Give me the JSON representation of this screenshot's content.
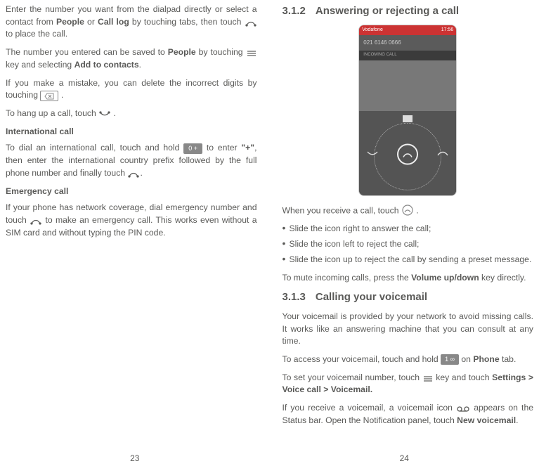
{
  "leftPage": {
    "p1_a": "Enter the number you want from the dialpad directly or select a contact from ",
    "p1_b": "People",
    "p1_c": " or ",
    "p1_d": "Call log",
    "p1_e": " by touching tabs, then touch ",
    "p1_f": " to place the call.",
    "p2_a": "The number you entered can be saved to ",
    "p2_b": "People",
    "p2_c": " by touching ",
    "p2_d": " key and selecting ",
    "p2_e": "Add to contacts",
    "p2_f": ".",
    "p3_a": "If you make a mistake, you can delete the incorrect digits by touching ",
    "p3_b": " .",
    "p4_a": "To hang up a call, touch ",
    "p4_b": " .",
    "h1": "International call",
    "p5_a": "To dial an international call, touch and hold ",
    "p5_key": "0 +",
    "p5_b": " to enter ",
    "p5_c": "\"+\"",
    "p5_d": ", then enter the international country prefix followed by the full phone number and finally touch ",
    "p5_e": ".",
    "h2": "Emergency call",
    "p6_a": "If your phone has network coverage, dial emergency number and touch ",
    "p6_b": " to make an emergency call. This works even without a SIM card and without typing the PIN code.",
    "num": "23"
  },
  "rightPage": {
    "heading312_num": "3.1.2",
    "heading312": "Answering or rejecting a call",
    "phone": {
      "carrier": "Vodafone",
      "time": "17:56",
      "number": "021 6146 0666",
      "label": "INCOMING CALL"
    },
    "p1_a": "When you receive a call, touch ",
    "p1_b": " .",
    "b1": "Slide the icon right to answer the call;",
    "b2": "Slide the icon left to reject the call;",
    "b3": "Slide the icon up to reject the call by sending a preset message.",
    "p2_a": "To mute incoming calls, press the ",
    "p2_b": "Volume up/down",
    "p2_c": " key directly.",
    "heading313_num": "3.1.3",
    "heading313": "Calling your voicemail",
    "p3": "Your voicemail is provided by your network to avoid missing calls. It works like an answering machine that you can consult at any time.",
    "p4_a": "To access your voicemail, touch and hold ",
    "p4_key": "1 ∞",
    "p4_b": " on ",
    "p4_c": "Phone",
    "p4_d": " tab.",
    "p5_a": "To set your voicemail number, touch ",
    "p5_b": " key and touch ",
    "p5_c": "Settings > Voice call > Voicemail.",
    "p6_a": "If you receive a voicemail, a voicemail icon ",
    "p6_b": " appears on the Status bar. Open the Notification panel, touch ",
    "p6_c": "New voicemail",
    "p6_d": ".",
    "num": "24"
  }
}
